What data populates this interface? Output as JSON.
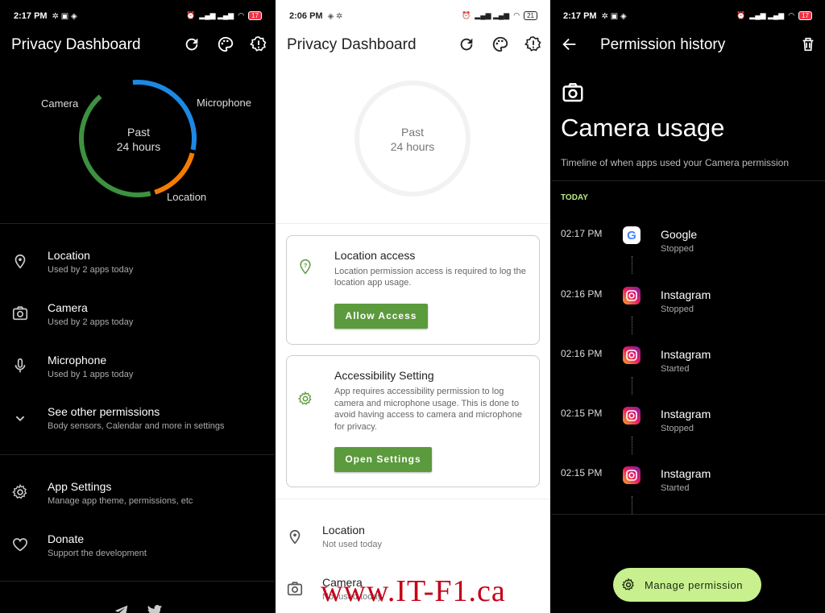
{
  "panel_dark": {
    "status": {
      "time": "2:17 PM",
      "battery": "17"
    },
    "title": "Privacy Dashboard",
    "chart": {
      "center_line1": "Past",
      "center_line2": "24 hours",
      "labels": {
        "camera": "Camera",
        "microphone": "Microphone",
        "location": "Location"
      },
      "colors": {
        "camera": "#1e88e5",
        "microphone": "#f57c00",
        "location": "#3d9140"
      }
    },
    "items": [
      {
        "title": "Location",
        "sub": "Used by 2 apps today"
      },
      {
        "title": "Camera",
        "sub": "Used by 2 apps today"
      },
      {
        "title": "Microphone",
        "sub": "Used by 1 apps today"
      },
      {
        "title": "See other permissions",
        "sub": "Body sensors, Calendar and more in settings"
      }
    ],
    "settings": [
      {
        "title": "App Settings",
        "sub": "Manage app theme, permissions, etc"
      },
      {
        "title": "Donate",
        "sub": "Support the development"
      }
    ]
  },
  "panel_light": {
    "status": {
      "time": "2:06 PM",
      "battery": "21"
    },
    "title": "Privacy Dashboard",
    "chart": {
      "center_line1": "Past",
      "center_line2": "24 hours"
    },
    "card_location": {
      "title": "Location access",
      "body": "Location permission access is required to log the location app usage.",
      "button": "Allow Access"
    },
    "card_access": {
      "title": "Accessibility Setting",
      "body": "App requires accessibility permission to log camera and microphone usage. This is done to avoid having access to camera and microphone for privacy.",
      "button": "Open Settings"
    },
    "items": [
      {
        "title": "Location",
        "sub": "Not used today"
      },
      {
        "title": "Camera",
        "sub": "Not used today"
      }
    ]
  },
  "panel_history": {
    "status": {
      "time": "2:17 PM",
      "battery": "17"
    },
    "title": "Permission history",
    "heading": "Camera usage",
    "subtitle": "Timeline of when apps used your Camera permission",
    "section": "TODAY",
    "entries": [
      {
        "time": "02:17 PM",
        "app": "Google",
        "state": "Stopped"
      },
      {
        "time": "02:16 PM",
        "app": "Instagram",
        "state": "Stopped"
      },
      {
        "time": "02:16 PM",
        "app": "Instagram",
        "state": "Started"
      },
      {
        "time": "02:15 PM",
        "app": "Instagram",
        "state": "Stopped"
      },
      {
        "time": "02:15 PM",
        "app": "Instagram",
        "state": "Started"
      }
    ],
    "fab": "Manage permission"
  },
  "watermark": "www.IT-F1.ca"
}
